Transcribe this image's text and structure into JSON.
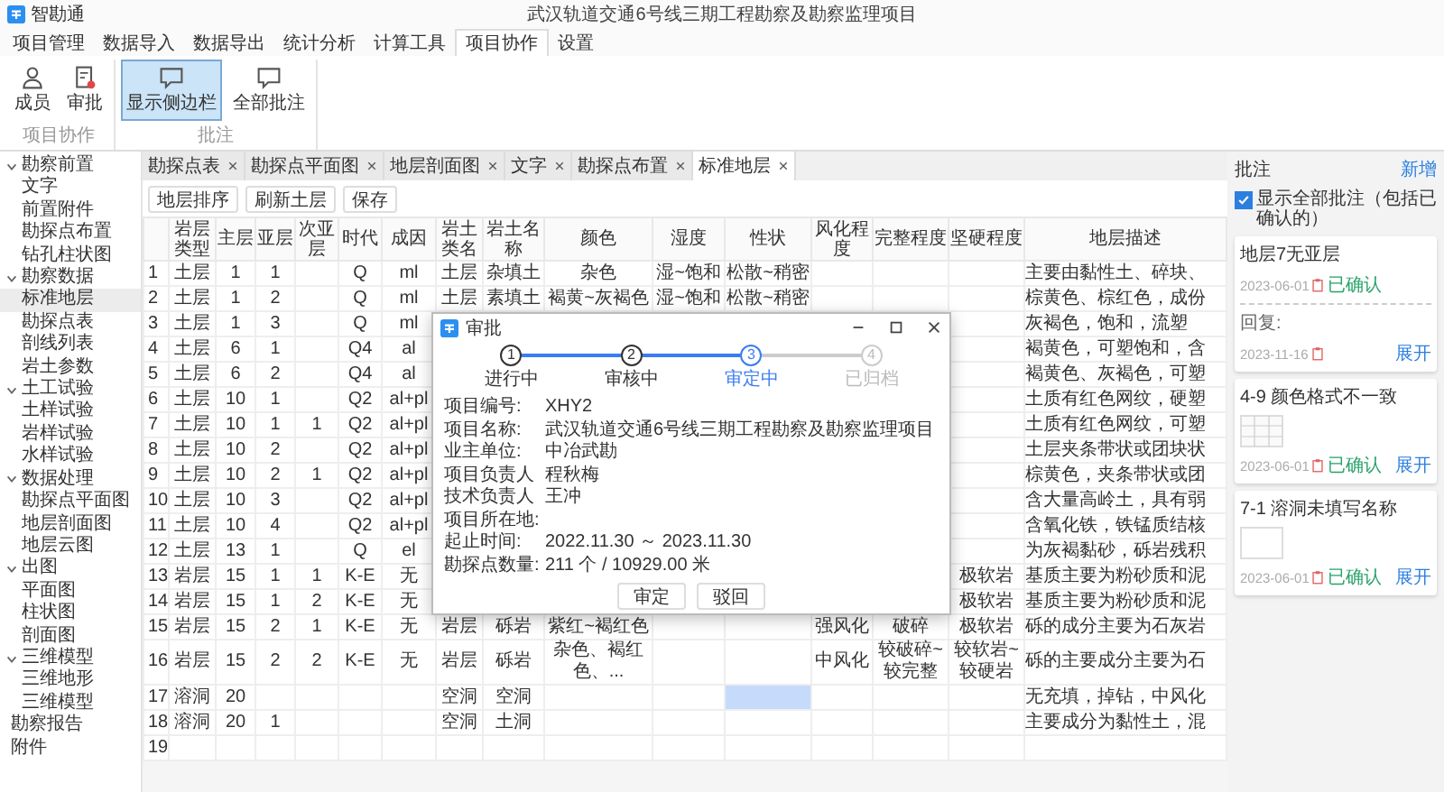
{
  "window": {
    "app_name": "智勘通",
    "title": "武汉轨道交通6号线三期工程勘察及勘察监理项目"
  },
  "menu": [
    {
      "label": "项目管理",
      "selected": false
    },
    {
      "label": "数据导入",
      "selected": false
    },
    {
      "label": "数据导出",
      "selected": false
    },
    {
      "label": "统计分析",
      "selected": false
    },
    {
      "label": "计算工具",
      "selected": false
    },
    {
      "label": "项目协作",
      "selected": true
    },
    {
      "label": "设置",
      "selected": false
    }
  ],
  "ribbon": [
    {
      "label": "项目协作",
      "buttons": [
        {
          "label": "成员",
          "pressed": false
        },
        {
          "label": "审批",
          "pressed": false
        }
      ]
    },
    {
      "label": "批注",
      "buttons": [
        {
          "label": "显示侧边栏",
          "pressed": true
        },
        {
          "label": "全部批注",
          "pressed": false
        }
      ]
    }
  ],
  "sidebar": {
    "items": [
      {
        "label": "勘察前置",
        "expanded": true,
        "children": [
          {
            "label": "文字",
            "selected": false
          },
          {
            "label": "前置附件",
            "selected": false
          },
          {
            "label": "勘探点布置",
            "selected": false
          },
          {
            "label": "钻孔柱状图",
            "selected": false
          }
        ]
      },
      {
        "label": "勘察数据",
        "expanded": true,
        "children": [
          {
            "label": "标准地层",
            "selected": true
          },
          {
            "label": "勘探点表",
            "selected": false
          },
          {
            "label": "剖线列表",
            "selected": false
          },
          {
            "label": "岩土参数",
            "selected": false
          }
        ]
      },
      {
        "label": "土工试验",
        "expanded": true,
        "children": [
          {
            "label": "土样试验",
            "selected": false
          },
          {
            "label": "岩样试验",
            "selected": false
          },
          {
            "label": "水样试验",
            "selected": false
          }
        ]
      },
      {
        "label": "数据处理",
        "expanded": true,
        "children": [
          {
            "label": "勘探点平面图",
            "selected": false
          },
          {
            "label": "地层剖面图",
            "selected": false
          },
          {
            "label": "地层云图",
            "selected": false
          }
        ]
      },
      {
        "label": "出图",
        "expanded": true,
        "children": [
          {
            "label": "平面图",
            "selected": false
          },
          {
            "label": "柱状图",
            "selected": false
          },
          {
            "label": "剖面图",
            "selected": false
          }
        ]
      },
      {
        "label": "三维模型",
        "expanded": true,
        "children": [
          {
            "label": "三维地形",
            "selected": false
          },
          {
            "label": "三维模型",
            "selected": false
          }
        ]
      },
      {
        "label": "勘察报告",
        "selected": false
      },
      {
        "label": "附件",
        "selected": false
      }
    ]
  },
  "tabs": [
    {
      "label": "勘探点表",
      "selected": false
    },
    {
      "label": "勘探点平面图",
      "selected": false
    },
    {
      "label": "地层剖面图",
      "selected": false
    },
    {
      "label": "文字",
      "selected": false
    },
    {
      "label": "勘探点布置",
      "selected": false
    },
    {
      "label": "标准地层",
      "selected": true
    }
  ],
  "toolbar": [
    "地层排序",
    "刷新土层",
    "保存"
  ],
  "table": {
    "columns": [
      "岩层类型",
      "主层",
      "亚层",
      "次亚层",
      "时代",
      "成因",
      "岩土类名",
      "岩土名称",
      "颜色",
      "湿度",
      "性状",
      "风化程度",
      "完整程度",
      "坚硬程度",
      "地层描述"
    ],
    "rows": [
      {
        "num": "1",
        "cells": [
          "土层",
          "1",
          "1",
          null,
          "Q",
          "ml",
          "土层",
          "杂填土",
          "杂色",
          "湿~饱和",
          "松散~稍密",
          null,
          null,
          null,
          "主要由黏性土、碎块、"
        ]
      },
      {
        "num": "2",
        "cells": [
          "土层",
          "1",
          "2",
          null,
          "Q",
          "ml",
          "土层",
          "素填土",
          "褐黄~灰褐色",
          "湿~饱和",
          "松散~稍密",
          null,
          null,
          null,
          "棕黄色、棕红色，成份"
        ]
      },
      {
        "num": "3",
        "cells": [
          "土层",
          "1",
          "3",
          null,
          "Q",
          "ml",
          null,
          null,
          null,
          null,
          null,
          null,
          null,
          null,
          "灰褐色，饱和，流塑"
        ]
      },
      {
        "num": "4",
        "cells": [
          "土层",
          "6",
          "1",
          null,
          "Q4",
          "al",
          null,
          null,
          null,
          null,
          null,
          null,
          null,
          null,
          "褐黄色，可塑饱和，含"
        ]
      },
      {
        "num": "5",
        "cells": [
          "土层",
          "6",
          "2",
          null,
          "Q4",
          "al",
          null,
          null,
          null,
          null,
          null,
          null,
          null,
          null,
          "褐黄色、灰褐色，可塑"
        ]
      },
      {
        "num": "6",
        "cells": [
          "土层",
          "10",
          "1",
          null,
          "Q2",
          "al+pl",
          null,
          null,
          null,
          null,
          null,
          null,
          null,
          null,
          "土质有红色网纹，硬塑"
        ]
      },
      {
        "num": "7",
        "cells": [
          "土层",
          "10",
          "1",
          "1",
          "Q2",
          "al+pl",
          null,
          null,
          null,
          null,
          null,
          null,
          null,
          null,
          "土质有红色网纹，可塑"
        ]
      },
      {
        "num": "8",
        "cells": [
          "土层",
          "10",
          "2",
          null,
          "Q2",
          "al+pl",
          null,
          null,
          null,
          null,
          null,
          null,
          null,
          null,
          "土层夹条带状或团块状"
        ]
      },
      {
        "num": "9",
        "cells": [
          "土层",
          "10",
          "2",
          "1",
          "Q2",
          "al+pl",
          null,
          null,
          null,
          null,
          null,
          null,
          null,
          null,
          "棕黄色，夹条带状或团"
        ]
      },
      {
        "num": "10",
        "cells": [
          "土层",
          "10",
          "3",
          null,
          "Q2",
          "al+pl",
          null,
          null,
          null,
          null,
          null,
          null,
          null,
          null,
          "含大量高岭土，具有弱"
        ]
      },
      {
        "num": "11",
        "cells": [
          "土层",
          "10",
          "4",
          null,
          "Q2",
          "al+pl",
          null,
          null,
          null,
          null,
          null,
          null,
          null,
          null,
          "含氧化铁，铁锰质结核"
        ]
      },
      {
        "num": "12",
        "cells": [
          "土层",
          "13",
          "1",
          null,
          "Q",
          "el",
          null,
          null,
          null,
          null,
          null,
          null,
          null,
          null,
          "为灰褐黏砂，砾岩残积"
        ]
      },
      {
        "num": "13",
        "cells": [
          "岩层",
          "15",
          "1",
          "1",
          "K-E",
          "无",
          null,
          null,
          null,
          null,
          null,
          null,
          null,
          "极软岩",
          "基质主要为粉砂质和泥"
        ]
      },
      {
        "num": "14",
        "cells": [
          "岩层",
          "15",
          "1",
          "2",
          "K-E",
          "无",
          null,
          null,
          null,
          null,
          null,
          null,
          null,
          "极软岩",
          "基质主要为粉砂质和泥"
        ]
      },
      {
        "num": "15",
        "cells": [
          "岩层",
          "15",
          "2",
          "1",
          "K-E",
          "无",
          "岩层",
          "砾岩",
          "紫红~褐红色",
          null,
          null,
          "强风化",
          "破碎",
          "极软岩",
          "砾的成分主要为石灰岩"
        ]
      },
      {
        "num": "16",
        "cells": [
          "岩层",
          "15",
          "2",
          "2",
          "K-E",
          "无",
          "岩层",
          "砾岩",
          "杂色、褐红色、...",
          null,
          null,
          "中风化",
          "较破碎~较完整",
          "较软岩~较硬岩",
          "砾的主要成分主要为石"
        ]
      },
      {
        "num": "17",
        "cells": [
          "溶洞",
          "20",
          null,
          null,
          null,
          null,
          "空洞",
          "空洞",
          null,
          null,
          {
            "selected": true
          },
          null,
          null,
          null,
          "无充填，掉钻，中风化"
        ]
      },
      {
        "num": "18",
        "cells": [
          "溶洞",
          "20",
          "1",
          null,
          null,
          null,
          "空洞",
          "土洞",
          null,
          null,
          null,
          null,
          null,
          null,
          "主要成分为黏性土，混"
        ]
      },
      {
        "num": "19"
      }
    ]
  },
  "dialog": {
    "title": "审批",
    "steps": [
      {
        "number": "1",
        "label": "进行中",
        "completed": true,
        "current": false
      },
      {
        "number": "2",
        "label": "审核中",
        "completed": true,
        "current": false
      },
      {
        "number": "3",
        "label": "审定中",
        "completed": false,
        "current": true
      },
      {
        "number": "4",
        "label": "已归档",
        "completed": false,
        "current": false
      }
    ],
    "fields": [
      {
        "label": "项目编号:",
        "value": "XHY2"
      },
      {
        "label": "项目名称:",
        "value": "武汉轨道交通6号线三期工程勘察及勘察监理项目"
      },
      {
        "label": "业主单位:",
        "value": "中冶武勘"
      },
      {
        "label": "项目负责人",
        "value": "程秋梅"
      },
      {
        "label": "技术负责人",
        "value": "王冲"
      },
      {
        "label": "项目所在地:"
      },
      {
        "label": "起止时间:",
        "value": "2022.11.30 ～ 2023.11.30"
      },
      {
        "label": "勘探点数量:",
        "value": "211 个 / 10929.00 米"
      }
    ],
    "buttons": [
      "审定",
      "驳回"
    ]
  },
  "comments": {
    "title": "批注",
    "add": "新增",
    "show_all": {
      "label": "显示全部批注（包括已确认的）",
      "checked": true
    },
    "cards": [
      {
        "title": "地层7无亚层",
        "date": "2023-06-01",
        "status": "已确认",
        "reply": {
          "label": "回复:",
          "date": "2023-11-16"
        },
        "expand": "展开"
      },
      {
        "title": "4-9 颜色格式不一致",
        "attachment": true,
        "attachment_grid": true,
        "date": "2023-06-01",
        "status": "已确认",
        "expand": "展开"
      },
      {
        "title": "7-1 溶洞未填写名称",
        "attachment": true,
        "attachment_grid": false,
        "date": "2023-06-01",
        "status": "已确认",
        "expand": "展开"
      }
    ]
  }
}
